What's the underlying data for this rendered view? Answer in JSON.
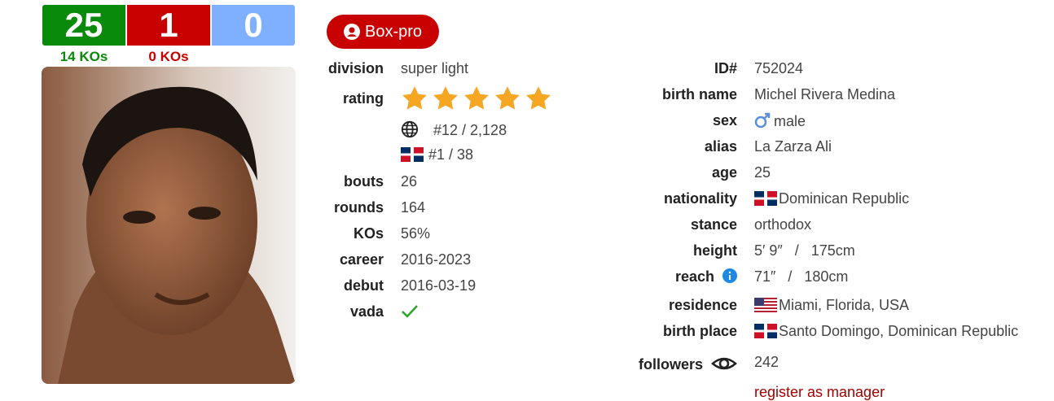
{
  "record": {
    "wins": "25",
    "losses": "1",
    "draws": "0",
    "win_kos": "14 KOs",
    "loss_kos": "0 KOs"
  },
  "badge": {
    "label": "Box-pro",
    "icon": "user-circle-icon"
  },
  "left": {
    "division_label": "division",
    "division": "super light",
    "rating_label": "rating",
    "stars": 5,
    "world_rank": "#12 / 2,128",
    "country_rank": "#1 / 38",
    "bouts_label": "bouts",
    "bouts": "26",
    "rounds_label": "rounds",
    "rounds": "164",
    "kos_label": "KOs",
    "kos": "56%",
    "career_label": "career",
    "career": "2016-2023",
    "debut_label": "debut",
    "debut": "2016-03-19",
    "vada_label": "vada"
  },
  "right": {
    "id_label": "ID#",
    "id": "752024",
    "birth_name_label": "birth name",
    "birth_name": "Michel Rivera Medina",
    "sex_label": "sex",
    "sex": "male",
    "alias_label": "alias",
    "alias": "La Zarza Ali",
    "age_label": "age",
    "age": "25",
    "nationality_label": "nationality",
    "nationality": "Dominican Republic",
    "stance_label": "stance",
    "stance": "orthodox",
    "height_label": "height",
    "height": "5′ 9″   /   175cm",
    "reach_label": "reach",
    "reach": "71″   /   180cm",
    "residence_label": "residence",
    "residence": "Miami, Florida, USA",
    "birth_place_label": "birth place",
    "birth_place": "Santo Domingo, Dominican Republic",
    "followers_label": "followers",
    "followers": "242",
    "register_link": "register as manager"
  },
  "colors": {
    "win": "#0a8a0a",
    "loss": "#c80000",
    "draw": "#7fb0ff",
    "star": "#f5a623",
    "accent": "#c80000"
  }
}
